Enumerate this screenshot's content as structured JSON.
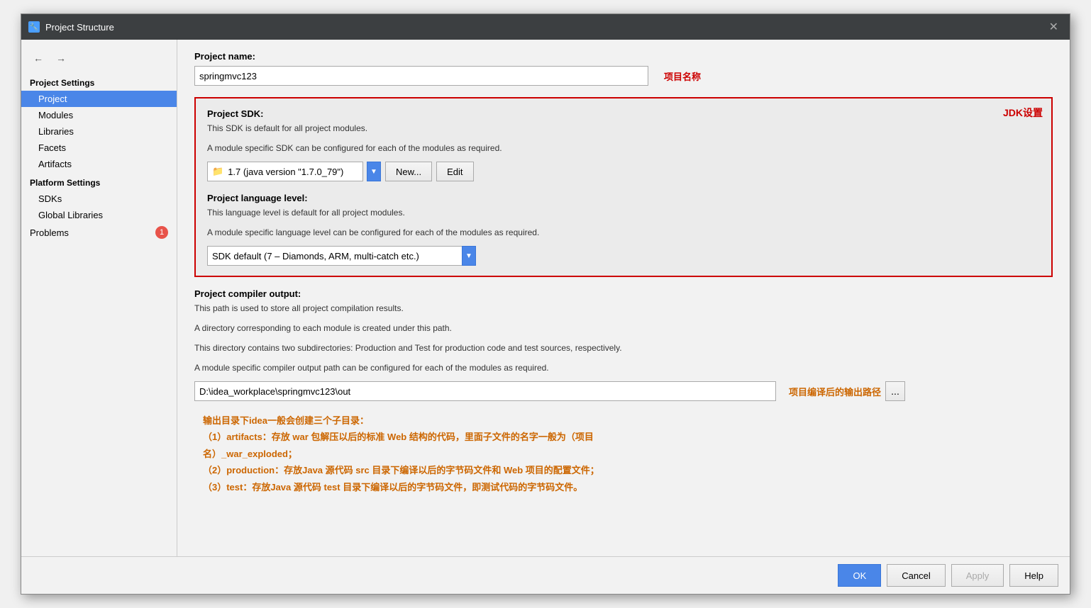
{
  "dialog": {
    "title": "Project Structure",
    "icon": "🔧",
    "close_label": "✕"
  },
  "nav_arrows": {
    "back_label": "←",
    "forward_label": "→"
  },
  "sidebar": {
    "project_settings_header": "Project Settings",
    "items": [
      {
        "id": "project",
        "label": "Project",
        "active": true
      },
      {
        "id": "modules",
        "label": "Modules",
        "active": false
      },
      {
        "id": "libraries",
        "label": "Libraries",
        "active": false
      },
      {
        "id": "facets",
        "label": "Facets",
        "active": false
      },
      {
        "id": "artifacts",
        "label": "Artifacts",
        "active": false
      }
    ],
    "platform_settings_header": "Platform Settings",
    "platform_items": [
      {
        "id": "sdks",
        "label": "SDKs",
        "active": false
      },
      {
        "id": "global-libraries",
        "label": "Global Libraries",
        "active": false
      }
    ],
    "problems_label": "Problems",
    "problems_badge": "1"
  },
  "main": {
    "project_name_label": "Project name:",
    "project_name_annotation": "项目名称",
    "project_name_value": "springmvc123",
    "sdk_section": {
      "title": "Project SDK:",
      "desc_line1": "This SDK is default for all project modules.",
      "desc_line2": "A module specific SDK can be configured for each of the modules as required.",
      "jdk_annotation": "JDK设置",
      "sdk_value": "1.7 (java version \"1.7.0_79\")",
      "btn_new": "New...",
      "btn_edit": "Edit"
    },
    "lang_section": {
      "title": "Project language level:",
      "desc_line1": "This language level is default for all project modules.",
      "desc_line2": "A module specific language level can be configured for each of the modules as required.",
      "lang_value": "SDK default (7 – Diamonds, ARM, multi-catch etc.)"
    },
    "compiler_section": {
      "title": "Project compiler output:",
      "desc_line1": "This path is used to store all project compilation results.",
      "desc_line2": "A directory corresponding to each module is created under this path.",
      "desc_line3": "This directory contains two subdirectories: Production and Test for production code and test sources, respectively.",
      "desc_line4": "A module specific compiler output path can be configured for each of the modules as required.",
      "output_path": "D:\\idea_workplace\\springmvc123\\out",
      "output_annotation": "项目编译后的输出路径",
      "browse_label": "..."
    },
    "notes": {
      "header": "输出目录下idea一般会创建三个子目录：",
      "line1": "（1）artifacts：存放 war 包解压以后的标准 Web 结构的代码，里面子文件的名字一般为（项目",
      "line2": "名）_war_exploded；",
      "line3": "（2）production：存放Java 源代码 src 目录下编译以后的字节码文件和 Web 项目的配置文件；",
      "line4": "（3）test：存放Java 源代码 test 目录下编译以后的字节码文件，即测试代码的字节码文件。"
    }
  },
  "footer": {
    "ok_label": "OK",
    "cancel_label": "Cancel",
    "apply_label": "Apply",
    "help_label": "Help"
  }
}
